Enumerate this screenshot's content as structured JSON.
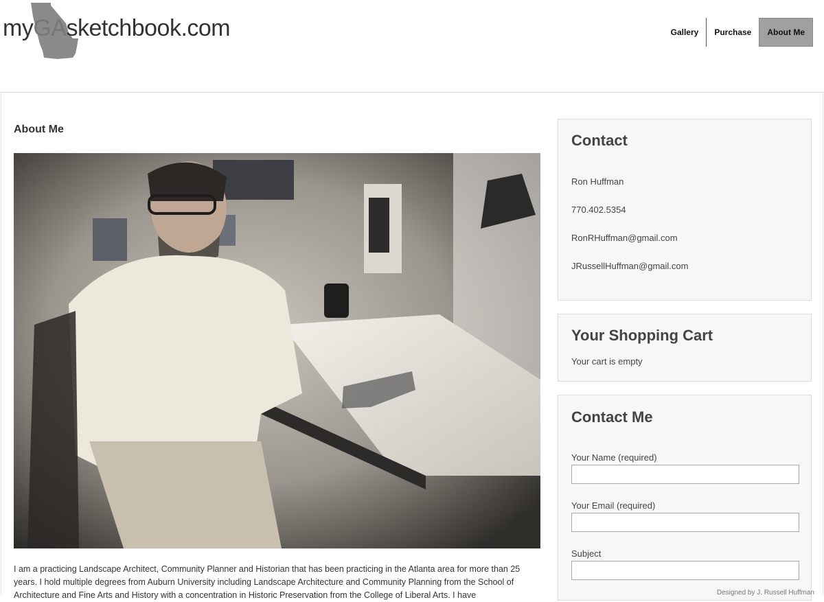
{
  "site": {
    "logo_prefix": "my",
    "logo_ga": "GA",
    "logo_suffix": "sketchbook.com"
  },
  "nav": {
    "items": [
      {
        "label": "Gallery",
        "active": false
      },
      {
        "label": "Purchase",
        "active": false
      },
      {
        "label": "About Me",
        "active": true
      }
    ]
  },
  "main": {
    "title": "About Me",
    "photo_icon": "artist-portrait-photo",
    "bio": "I am a practicing Landscape Architect, Community Planner and Historian that has been practicing in the Atlanta area for more than 25 years. I hold multiple degrees from Auburn University including Landscape Architecture and Community Planning from the School of Architecture and Fine Arts and History with a concentration in Historic Preservation from the College of Liberal Arts. I have"
  },
  "contact": {
    "title": "Contact",
    "name": "Ron Huffman",
    "phone": "770.402.5354",
    "email1": "RonRHuffman@gmail.com",
    "email2": "JRussellHuffman@gmail.com"
  },
  "cart": {
    "title": "Your Shopping Cart",
    "status": "Your cart is empty"
  },
  "contact_form": {
    "title": "Contact Me",
    "name_label": "Your Name (required)",
    "email_label": "Your Email (required)",
    "subject_label": "Subject",
    "name_value": "",
    "email_value": "",
    "subject_value": ""
  },
  "footer": {
    "credit": "Designed by J. Russell Huffman"
  },
  "colors": {
    "nav_active_bg": "#a0a0a0",
    "widget_bg": "#f7f7f7",
    "text": "#333333"
  }
}
